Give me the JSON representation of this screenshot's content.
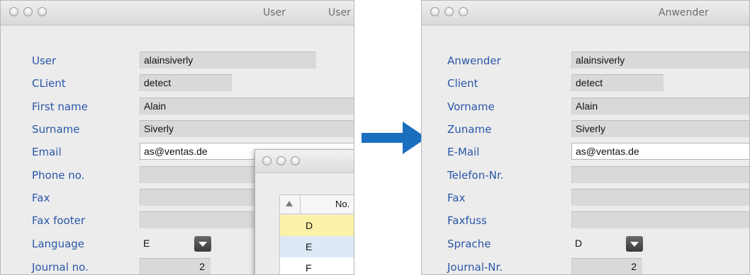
{
  "left": {
    "title": "User",
    "title_partial": "User",
    "fields": [
      {
        "label": "User",
        "value": "alainsiverly"
      },
      {
        "label": "CLient",
        "value": "detect"
      },
      {
        "label": "First name",
        "value": "Alain"
      },
      {
        "label": "Surname",
        "value": "Siverly"
      },
      {
        "label": "Email",
        "value": "as@ventas.de"
      },
      {
        "label": "Phone no.",
        "value": ""
      },
      {
        "label": "Fax",
        "value": ""
      },
      {
        "label": "Fax footer",
        "value": ""
      },
      {
        "label": "Language",
        "value": "E"
      },
      {
        "label": "Journal no.",
        "value": "2"
      }
    ],
    "popup": {
      "column_header": "No.",
      "rows": [
        "D",
        "E",
        "F"
      ],
      "row_colors": [
        "#fbf1a8",
        "#dde9f5",
        "#ffffff"
      ]
    }
  },
  "right": {
    "title": "Anwender",
    "fields": [
      {
        "label": "Anwender",
        "value": "alainsiverly"
      },
      {
        "label": "Client",
        "value": "detect"
      },
      {
        "label": "Vorname",
        "value": "Alain"
      },
      {
        "label": "Zuname",
        "value": "Siverly"
      },
      {
        "label": "E-Mail",
        "value": "as@ventas.de"
      },
      {
        "label": "Telefon-Nr.",
        "value": ""
      },
      {
        "label": "Fax",
        "value": ""
      },
      {
        "label": "Faxfuss",
        "value": ""
      },
      {
        "label": "Sprache",
        "value": "D"
      },
      {
        "label": "Journal-Nr.",
        "value": "2"
      }
    ]
  },
  "colors": {
    "label_blue": "#2a56a8",
    "arrow_blue": "#1a6fbf"
  },
  "icons": {
    "window_buttons": "traffic-light-icons",
    "dropdown": "chevron-down-icon",
    "sort": "sort-ascending-icon",
    "arrow": "arrow-right-icon"
  }
}
